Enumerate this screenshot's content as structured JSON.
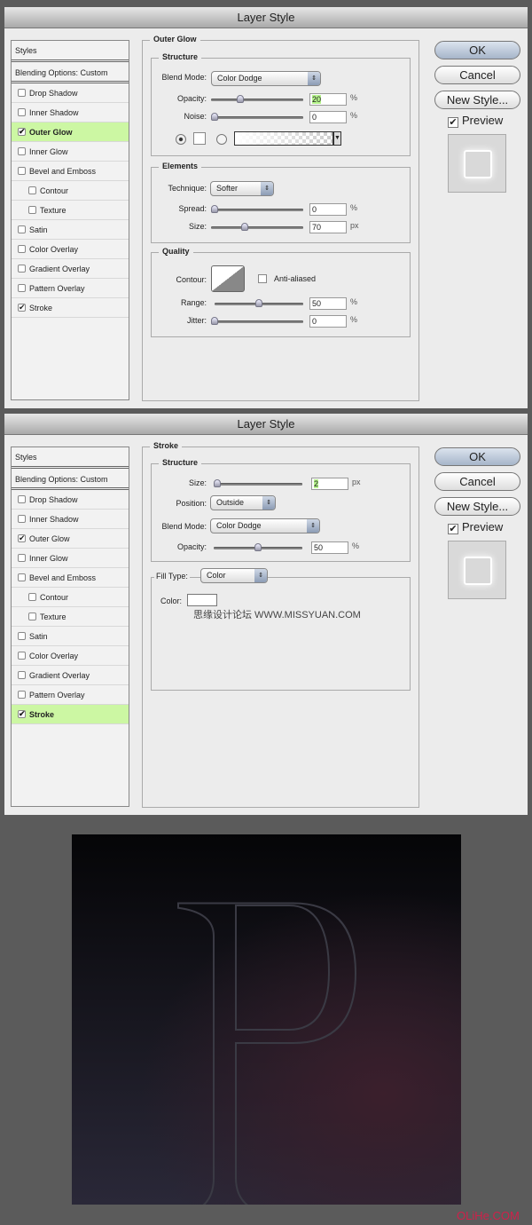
{
  "dialogs": [
    {
      "title": "Layer Style",
      "styles_header": "Styles",
      "blending": "Blending Options: Custom",
      "items": [
        {
          "label": "Drop Shadow",
          "checked": false
        },
        {
          "label": "Inner Shadow",
          "checked": false
        },
        {
          "label": "Outer Glow",
          "checked": true,
          "selected": true
        },
        {
          "label": "Inner Glow",
          "checked": false
        },
        {
          "label": "Bevel and Emboss",
          "checked": false
        },
        {
          "label": "Contour",
          "checked": false,
          "sub": true
        },
        {
          "label": "Texture",
          "checked": false,
          "sub": true
        },
        {
          "label": "Satin",
          "checked": false
        },
        {
          "label": "Color Overlay",
          "checked": false
        },
        {
          "label": "Gradient Overlay",
          "checked": false
        },
        {
          "label": "Pattern Overlay",
          "checked": false
        },
        {
          "label": "Stroke",
          "checked": true
        }
      ],
      "buttons": {
        "ok": "OK",
        "cancel": "Cancel",
        "new_style": "New Style...",
        "preview": "Preview"
      },
      "section": "Outer Glow",
      "structure": {
        "legend": "Structure",
        "blend_label": "Blend Mode:",
        "blend": "Color Dodge",
        "opacity_label": "Opacity:",
        "opacity": "20",
        "opacity_unit": "%",
        "noise_label": "Noise:",
        "noise": "0",
        "noise_unit": "%"
      },
      "elements": {
        "legend": "Elements",
        "technique_label": "Technique:",
        "technique": "Softer",
        "spread_label": "Spread:",
        "spread": "0",
        "spread_unit": "%",
        "size_label": "Size:",
        "size": "70",
        "size_unit": "px"
      },
      "quality": {
        "legend": "Quality",
        "contour_label": "Contour:",
        "anti_aliased": "Anti-aliased",
        "range_label": "Range:",
        "range": "50",
        "range_unit": "%",
        "jitter_label": "Jitter:",
        "jitter": "0",
        "jitter_unit": "%"
      }
    },
    {
      "title": "Layer Style",
      "styles_header": "Styles",
      "blending": "Blending Options: Custom",
      "items": [
        {
          "label": "Drop Shadow",
          "checked": false
        },
        {
          "label": "Inner Shadow",
          "checked": false
        },
        {
          "label": "Outer Glow",
          "checked": true
        },
        {
          "label": "Inner Glow",
          "checked": false
        },
        {
          "label": "Bevel and Emboss",
          "checked": false
        },
        {
          "label": "Contour",
          "checked": false,
          "sub": true
        },
        {
          "label": "Texture",
          "checked": false,
          "sub": true
        },
        {
          "label": "Satin",
          "checked": false
        },
        {
          "label": "Color Overlay",
          "checked": false
        },
        {
          "label": "Gradient Overlay",
          "checked": false
        },
        {
          "label": "Pattern Overlay",
          "checked": false
        },
        {
          "label": "Stroke",
          "checked": true,
          "selected": true
        }
      ],
      "buttons": {
        "ok": "OK",
        "cancel": "Cancel",
        "new_style": "New Style...",
        "preview": "Preview"
      },
      "section": "Stroke",
      "structure": {
        "legend": "Structure",
        "size_label": "Size:",
        "size": "2",
        "size_unit": "px",
        "position_label": "Position:",
        "position": "Outside",
        "blend_label": "Blend Mode:",
        "blend": "Color Dodge",
        "opacity_label": "Opacity:",
        "opacity": "50",
        "opacity_unit": "%"
      },
      "fill": {
        "label": "Fill Type:",
        "type": "Color",
        "color_label": "Color:"
      }
    }
  ],
  "watermark": "思缘设计论坛  WWW.MISSYUAN.COM",
  "corner_watermark": "OLiHe.COM",
  "colors": {
    "selected": "#ccf7a3",
    "highlight": "#b6f58c",
    "watermark": "#d0204a"
  }
}
